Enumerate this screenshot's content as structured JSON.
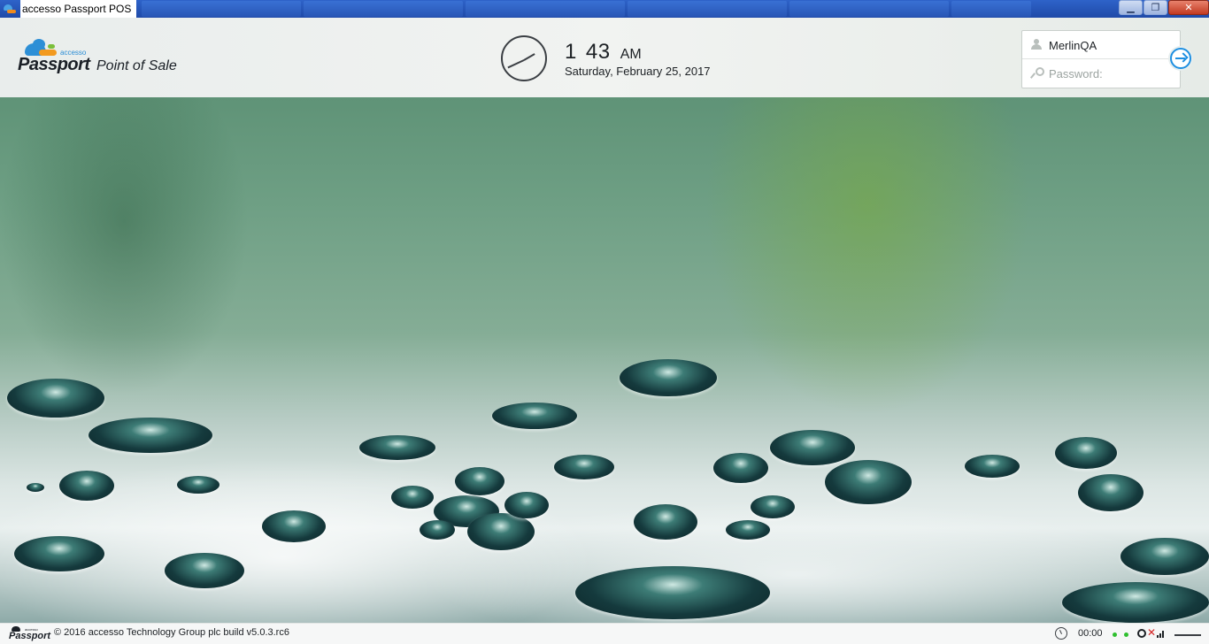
{
  "window": {
    "title": "accesso Passport POS",
    "buttons": {
      "minimize": "▁",
      "restore": "❐",
      "close": "✕"
    }
  },
  "header": {
    "logo": {
      "small_text": "accesso",
      "brand": "Passport",
      "product": "Point of Sale"
    },
    "clock": {
      "hour": "1",
      "minute": "43",
      "ampm": "AM",
      "date": "Saturday, February 25, 2017"
    },
    "login": {
      "username_value": "MerlinQA",
      "password_placeholder": "Password:"
    }
  },
  "footer": {
    "logo": {
      "small_text": "accesso",
      "brand": "Passport"
    },
    "copyright": "© 2016 accesso Technology Group plc build v5.0.3.rc6",
    "timer": "00:00"
  },
  "colors": {
    "accent": "#1e8fe1",
    "status_ok": "#2fbf2f",
    "status_error": "#d42424"
  }
}
